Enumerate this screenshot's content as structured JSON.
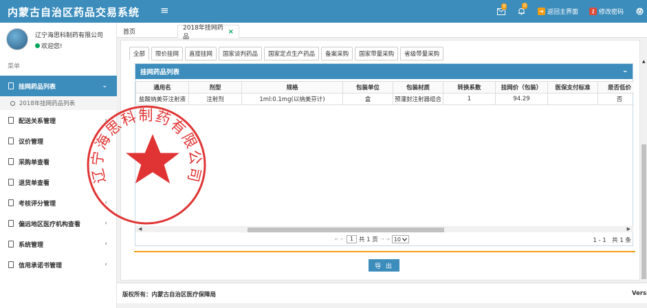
{
  "header": {
    "app_title": "内蒙古自治区药品交易系统",
    "menu_toggle": "≡",
    "mail_badge": "0",
    "bell_badge": "0",
    "back_home": "返回主界面",
    "change_password": "修改密码"
  },
  "sidebar": {
    "company_name": "辽宁海思科制药有限公司",
    "welcome": "欢迎您!",
    "menu_header": "菜单",
    "items": [
      {
        "label": "挂网药品列表",
        "chevron": "⌄"
      },
      {
        "label": "配送关系管理",
        "chevron": "‹"
      },
      {
        "label": "议价管理",
        "chevron": ""
      },
      {
        "label": "采购单查看",
        "chevron": ""
      },
      {
        "label": "退货单查看",
        "chevron": ""
      },
      {
        "label": "考核评分管理",
        "chevron": "‹"
      },
      {
        "label": "偏远地区医疗机构查看",
        "chevron": "‹"
      },
      {
        "label": "系统管理",
        "chevron": "‹"
      },
      {
        "label": "信用承诺书管理",
        "chevron": "‹"
      }
    ],
    "submenu_item": "2018年挂网药品列表"
  },
  "stamp": {
    "text": "辽宁海思科制药有限公司"
  },
  "tabs": {
    "home": "首页",
    "current": "2018年挂网药品",
    "close": "×"
  },
  "subtabs": [
    "全部",
    "限价挂网",
    "直接挂网",
    "国家谈判药品",
    "国家定点生产药品",
    "备案采购",
    "国家带量采购",
    "省级带量采购"
  ],
  "panel": {
    "title": "挂网药品列表",
    "collapse": "–",
    "columns": [
      "通用名",
      "剂型",
      "规格",
      "包装单位",
      "包装材质",
      "转换系数",
      "挂网价（包装）",
      "医保支付标准",
      "是否低价"
    ],
    "rows": [
      [
        "盐酸纳美芬注射液",
        "注射剂",
        "1ml:0.1mg(以纳美芬计)",
        "盒",
        "预灌封注射器组合",
        "1",
        "94.29",
        "",
        "否"
      ]
    ]
  },
  "pager": {
    "arrows_left": "⇤ ⇠",
    "page_input": "1",
    "total_pages": "共 1 页",
    "arrows_right": "⇢ ⇥",
    "page_size": "10",
    "range": "1 - 1　共 1 条"
  },
  "export_button": "导 出",
  "footer": {
    "copyright": "版权所有：内蒙古自治区医疗保障局",
    "version": "Versi"
  }
}
